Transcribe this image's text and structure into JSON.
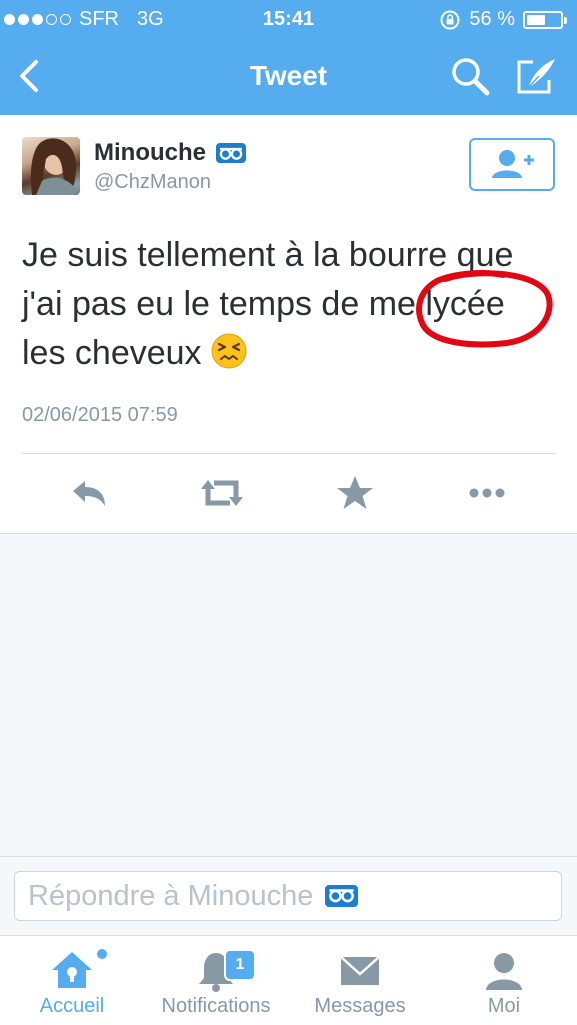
{
  "status_bar": {
    "carrier": "SFR",
    "network": "3G",
    "time": "15:41",
    "battery": "56 %",
    "battery_level": 0.56,
    "signal_bars_filled": 3,
    "signal_bars_total": 5
  },
  "nav": {
    "title": "Tweet",
    "back_icon": "chevron-left-icon",
    "search_icon": "search-icon",
    "compose_icon": "compose-icon"
  },
  "tweet": {
    "author_name": "Minouche",
    "author_handle": "@ChzManon",
    "text_lines": [
      "Je suis tellement à la bourre que",
      "j'ai pas eu le temps de me lycée",
      "les cheveux"
    ],
    "emoji": "persevering-face",
    "timestamp": "02/06/2015 07:59",
    "annotation_color": "#e30613"
  },
  "actions": {
    "reply_icon": "reply-icon",
    "retweet_icon": "retweet-icon",
    "favorite_icon": "star-icon",
    "more_icon": "more-icon"
  },
  "reply": {
    "placeholder": "Répondre à Minouche"
  },
  "tabs": [
    {
      "label": "Accueil",
      "icon": "home-icon",
      "active": true
    },
    {
      "label": "Notifications",
      "icon": "bell-icon",
      "badge": "1"
    },
    {
      "label": "Messages",
      "icon": "envelope-icon"
    },
    {
      "label": "Moi",
      "icon": "profile-icon"
    }
  ],
  "colors": {
    "brand": "#55acee",
    "text": "#292f33",
    "muted": "#8899a6",
    "badge": "#1d7dcf"
  }
}
